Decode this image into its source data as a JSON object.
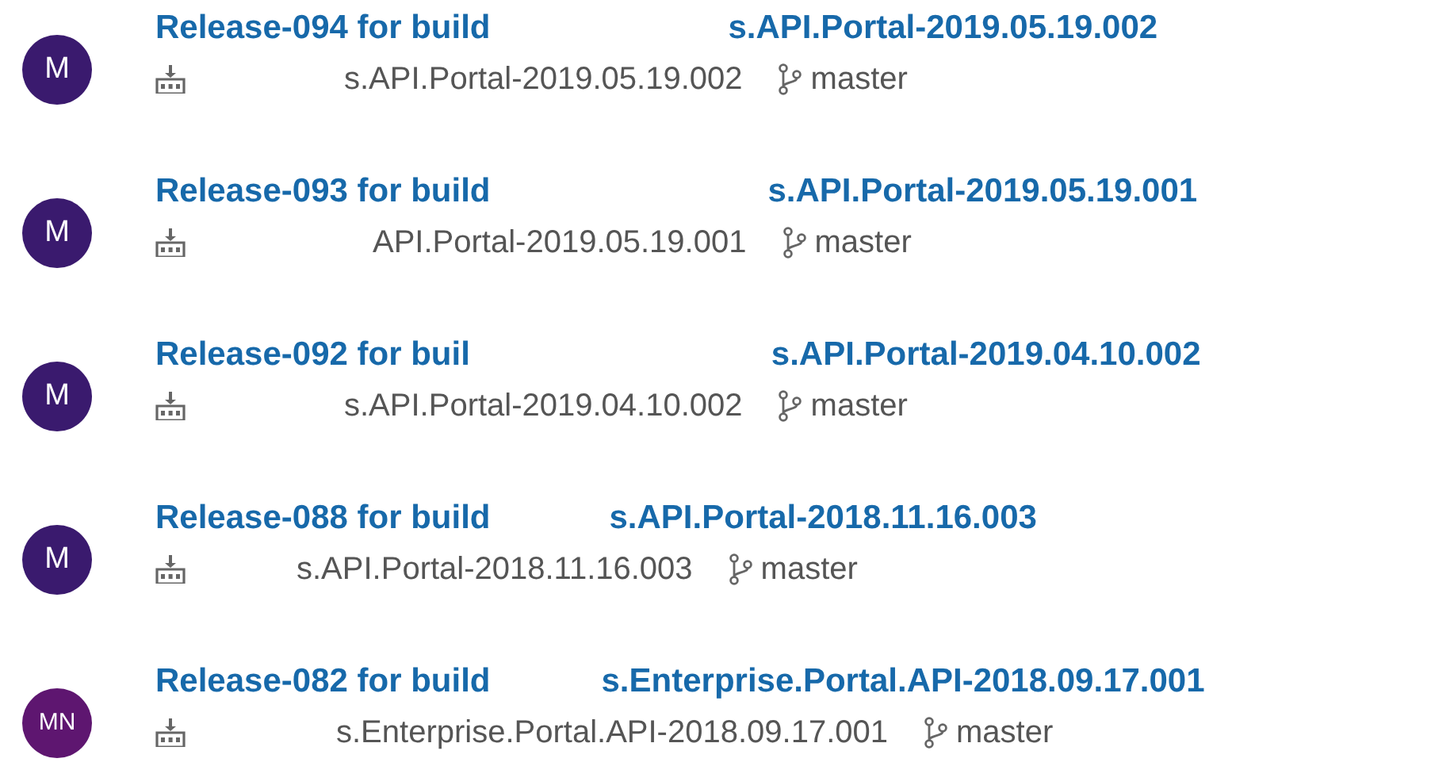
{
  "releases": [
    {
      "avatar": "M",
      "color": "#3a1a6e",
      "title": "Release-094 for build",
      "title_rest": "s.API.Portal-2019.05.19.002",
      "build": "s.API.Portal-2019.05.19.002",
      "branch": "master"
    },
    {
      "avatar": "M",
      "color": "#3a1a6e",
      "title": "Release-093 for build",
      "title_rest": "s.API.Portal-2019.05.19.001",
      "build": "API.Portal-2019.05.19.001",
      "branch": "master"
    },
    {
      "avatar": "M",
      "color": "#3a1a6e",
      "title": "Release-092 for buil",
      "title_rest": "s.API.Portal-2019.04.10.002",
      "build": "s.API.Portal-2019.04.10.002",
      "branch": "master"
    },
    {
      "avatar": "M",
      "color": "#3a1a6e",
      "title": "Release-088 for build",
      "title_rest": "s.API.Portal-2018.11.16.003",
      "build": "s.API.Portal-2018.11.16.003",
      "branch": "master"
    },
    {
      "avatar": "MN",
      "color": "#5e1670",
      "title": "Release-082 for build",
      "title_rest": "s.Enterprise.Portal.API-2018.09.17.001",
      "build": "s.Enterprise.Portal.API-2018.09.17.001",
      "branch": "master"
    }
  ]
}
